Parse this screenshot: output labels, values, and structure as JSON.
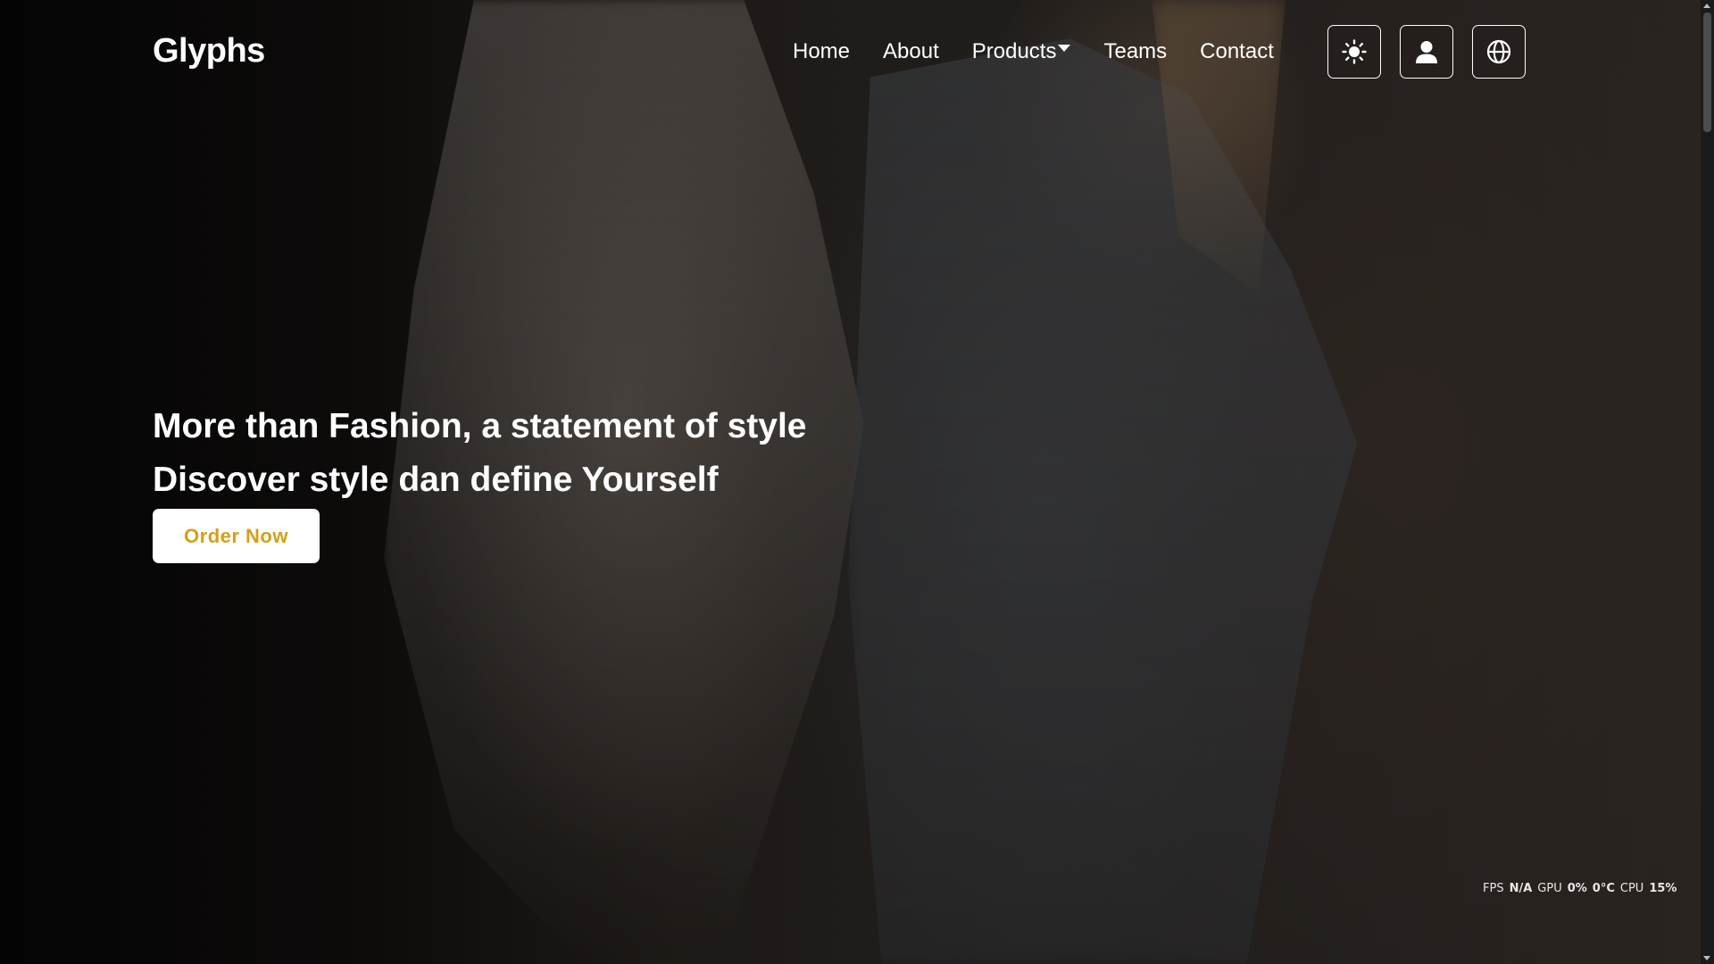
{
  "header": {
    "brand": "Glyphs",
    "nav": {
      "home": "Home",
      "about": "About",
      "products": "Products",
      "teams": "Teams",
      "contact": "Contact"
    },
    "icons": [
      "sun-icon",
      "user-icon",
      "globe-icon"
    ]
  },
  "hero": {
    "line1": "More than Fashion, a statement of style",
    "line2": "Discover style dan define Yourself",
    "cta": "Order Now"
  },
  "perf": {
    "fps_label": "FPS",
    "fps_value": "N/A",
    "gpu_label": "GPU",
    "gpu_value": "0%",
    "temp_value": "0°C",
    "cpu_label": "CPU",
    "cpu_value": "15%"
  },
  "colors": {
    "accent": "#d4a017",
    "text": "#ffffff"
  }
}
